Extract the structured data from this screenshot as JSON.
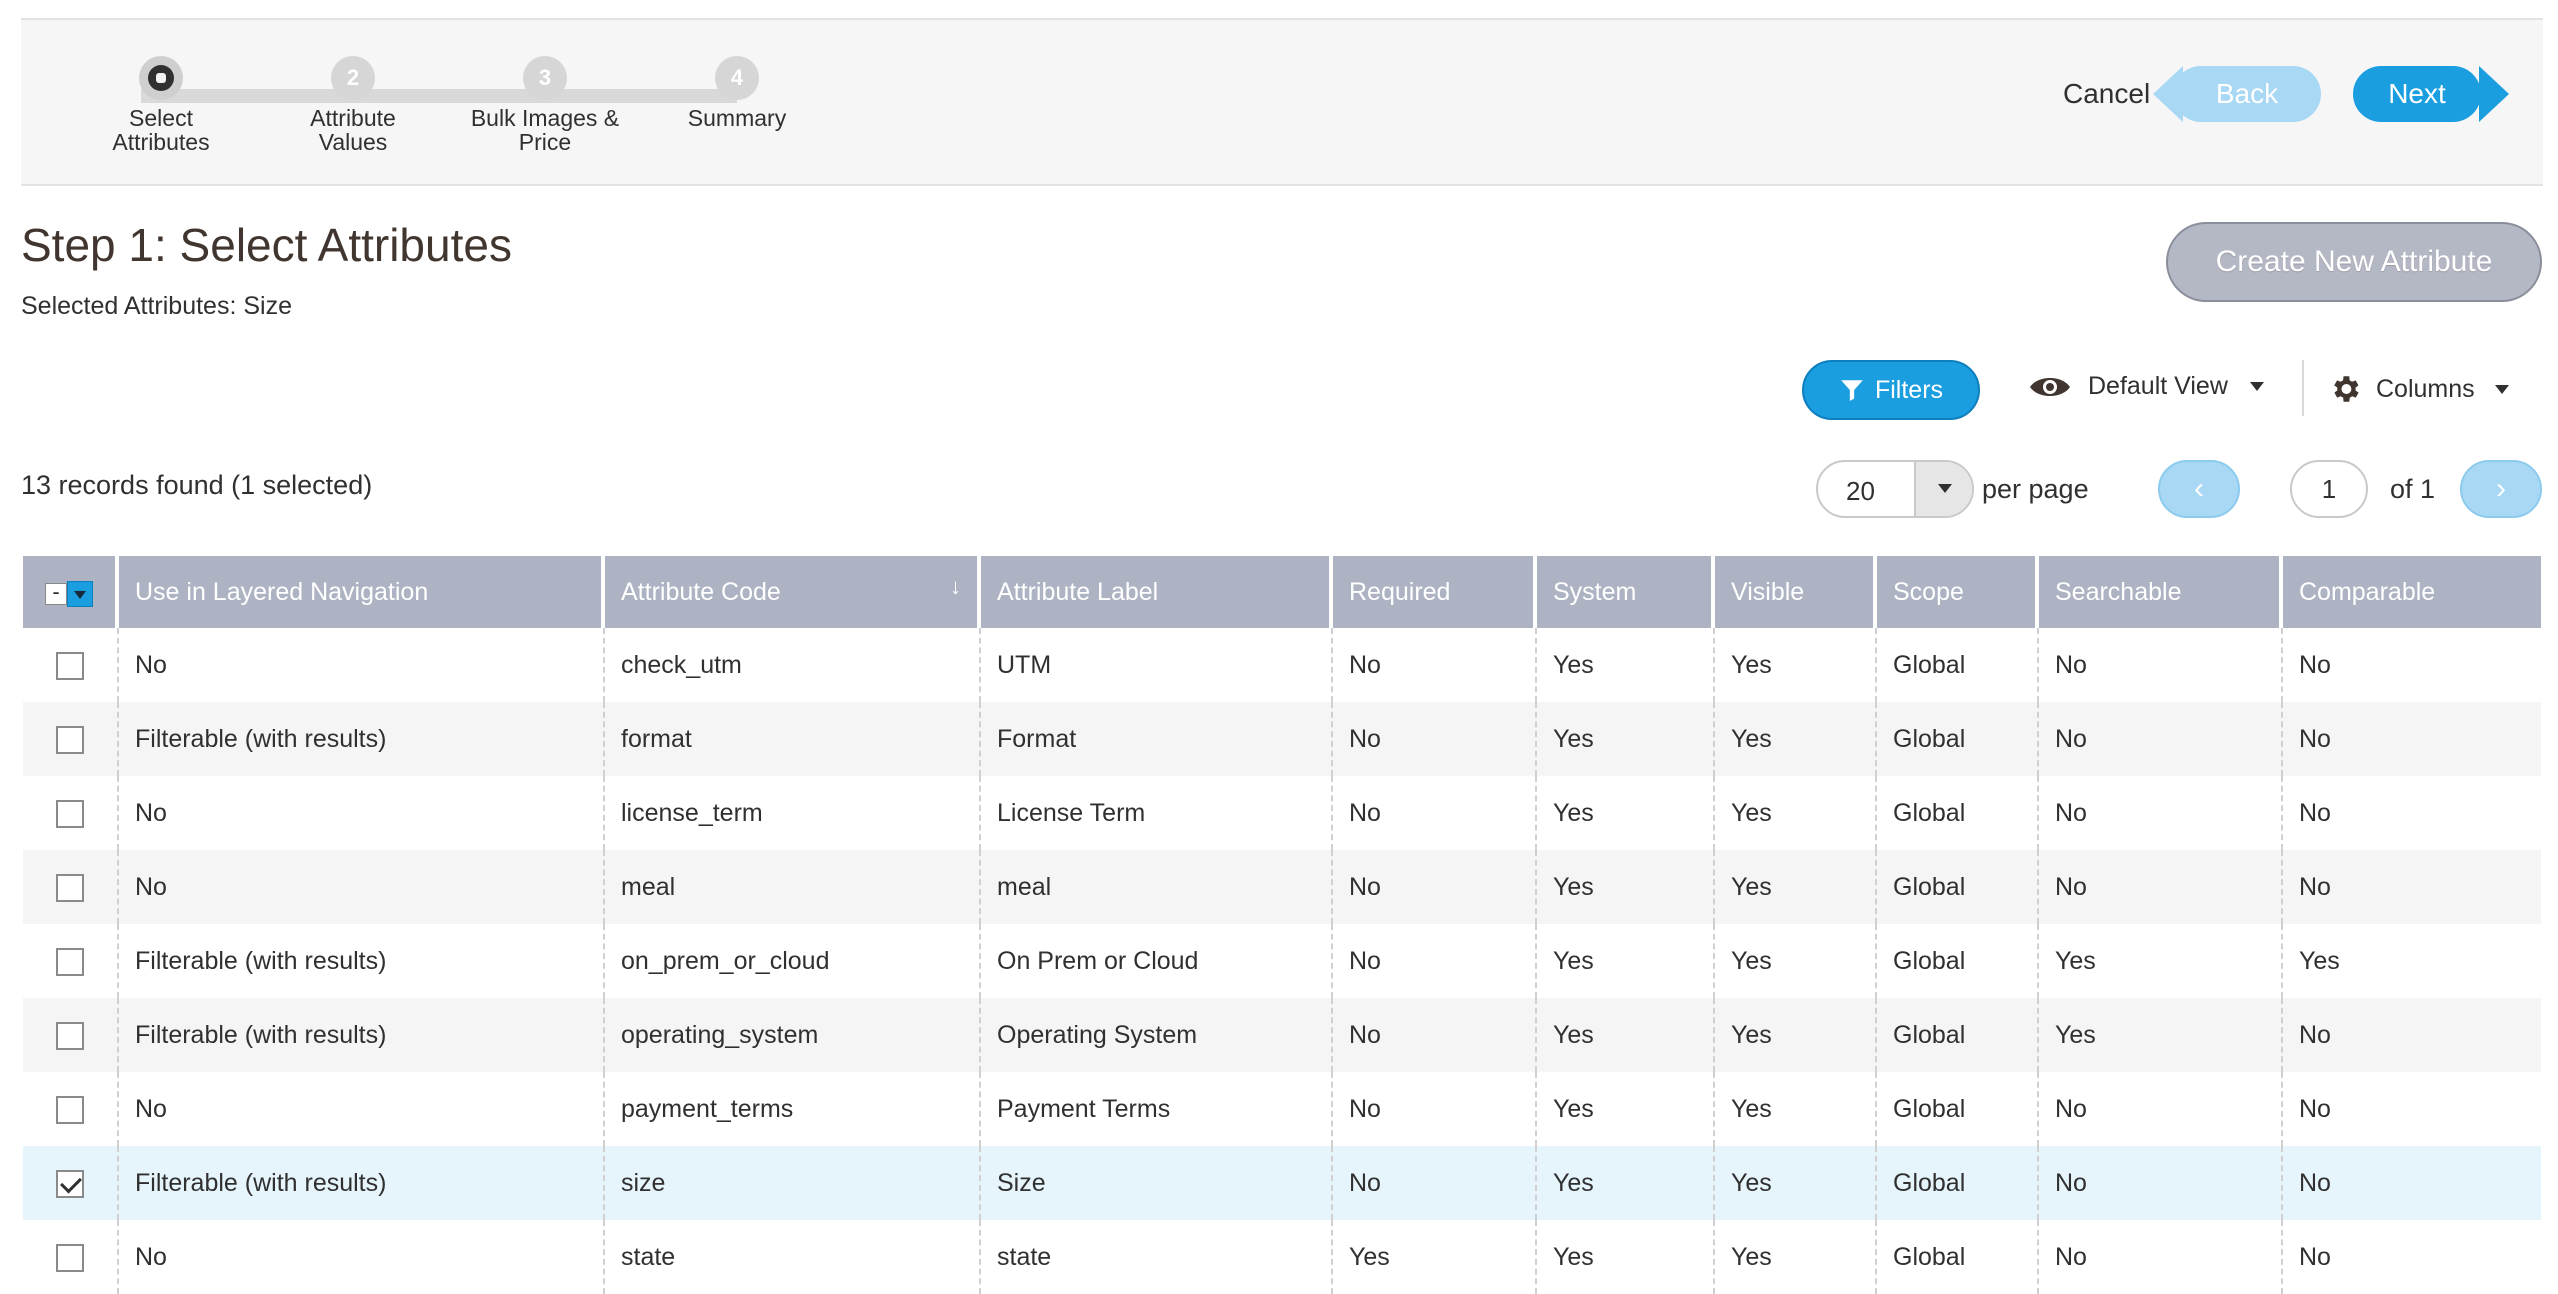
{
  "wizard": {
    "steps": [
      {
        "number": "",
        "label": "Select\nAttributes",
        "active": true
      },
      {
        "number": "2",
        "label": "Attribute\nValues",
        "active": false
      },
      {
        "number": "3",
        "label": "Bulk Images &\nPrice",
        "active": false
      },
      {
        "number": "4",
        "label": "Summary",
        "active": false
      }
    ],
    "cancel_label": "Cancel",
    "back_label": "Back",
    "next_label": "Next"
  },
  "page": {
    "title": "Step 1: Select Attributes",
    "selected_attributes": "Selected Attributes: Size",
    "create_button": "Create New Attribute"
  },
  "toolbar": {
    "filters_label": "Filters",
    "view_label": "Default View",
    "columns_label": "Columns",
    "records_text": "13 records found (1 selected)",
    "per_page_value": "20",
    "per_page_label": "per page",
    "current_page": "1",
    "total_pages_text": "of 1"
  },
  "icons": {
    "filter": "filter-icon",
    "view": "eye-icon",
    "columns": "gear-icon",
    "prev": "chevron-left-icon",
    "next": "chevron-right-icon"
  },
  "colors": {
    "accent": "#1a9ee0",
    "accent_light": "#a8d8f4",
    "header_bg": "#adb3c3",
    "selected_row": "#e6f4fb"
  },
  "grid": {
    "columns": [
      "Use in Layered Navigation",
      "Attribute Code",
      "Attribute Label",
      "Required",
      "System",
      "Visible",
      "Scope",
      "Searchable",
      "Comparable"
    ],
    "sorted_column": "Attribute Code",
    "rows": [
      {
        "checked": false,
        "cells": [
          "No",
          "check_utm",
          "UTM",
          "No",
          "Yes",
          "Yes",
          "Global",
          "No",
          "No"
        ]
      },
      {
        "checked": false,
        "cells": [
          "Filterable (with results)",
          "format",
          "Format",
          "No",
          "Yes",
          "Yes",
          "Global",
          "No",
          "No"
        ]
      },
      {
        "checked": false,
        "cells": [
          "No",
          "license_term",
          "License Term",
          "No",
          "Yes",
          "Yes",
          "Global",
          "No",
          "No"
        ]
      },
      {
        "checked": false,
        "cells": [
          "No",
          "meal",
          "meal",
          "No",
          "Yes",
          "Yes",
          "Global",
          "No",
          "No"
        ]
      },
      {
        "checked": false,
        "cells": [
          "Filterable (with results)",
          "on_prem_or_cloud",
          "On Prem or Cloud",
          "No",
          "Yes",
          "Yes",
          "Global",
          "Yes",
          "Yes"
        ]
      },
      {
        "checked": false,
        "cells": [
          "Filterable (with results)",
          "operating_system",
          "Operating System",
          "No",
          "Yes",
          "Yes",
          "Global",
          "Yes",
          "No"
        ]
      },
      {
        "checked": false,
        "cells": [
          "No",
          "payment_terms",
          "Payment Terms",
          "No",
          "Yes",
          "Yes",
          "Global",
          "No",
          "No"
        ]
      },
      {
        "checked": true,
        "cells": [
          "Filterable (with results)",
          "size",
          "Size",
          "No",
          "Yes",
          "Yes",
          "Global",
          "No",
          "No"
        ]
      },
      {
        "checked": false,
        "cells": [
          "No",
          "state",
          "state",
          "Yes",
          "Yes",
          "Yes",
          "Global",
          "No",
          "No"
        ]
      }
    ]
  }
}
